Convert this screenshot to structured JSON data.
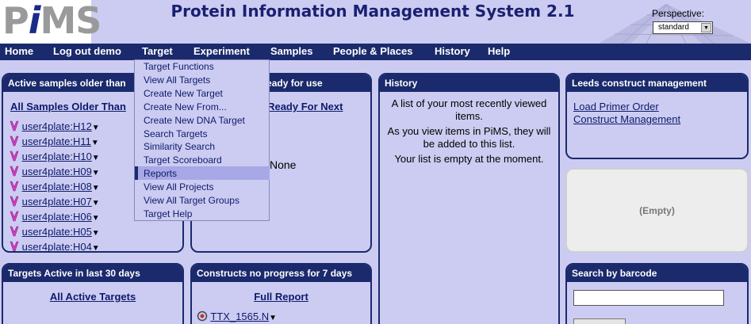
{
  "header": {
    "logo": "PiMS",
    "title": "Protein Information Management System 2.1",
    "perspective_label": "Perspective:",
    "perspective_value": "standard"
  },
  "nav": [
    "Home",
    "Log out demo",
    "Target",
    "Experiment",
    "Samples",
    "People & Places",
    "History",
    "Help"
  ],
  "target_menu": {
    "items": [
      "Target Functions",
      "View All Targets",
      "Create New Target",
      "Create New From...",
      "Create New DNA Target",
      "Search Targets",
      "Similarity Search",
      "Target Scoreboard",
      "Reports",
      "View All Projects",
      "View All Target Groups",
      "Target Help"
    ],
    "highlighted": "Reports"
  },
  "active_samples": {
    "title": "Active samples older than",
    "link": "All Samples Older Than",
    "items": [
      "user4plate:H12",
      "user4plate:H11",
      "user4plate:H10",
      "user4plate:H09",
      "user4plate:H08",
      "user4plate:H07",
      "user4plate:H06",
      "user4plate:H05",
      "user4plate:H04"
    ]
  },
  "ready_samples": {
    "title_visible": "e samples ready for use",
    "link_visible": "Samples Ready For Next",
    "value": "None"
  },
  "history": {
    "title": "History",
    "line1": "A list of your most recently viewed items.",
    "line2": "As you view items in PiMS, they will be added to this list.",
    "line3": "Your list is empty at the moment."
  },
  "leeds": {
    "title": "Leeds construct management",
    "links": [
      "Load Primer Order",
      "Construct Management"
    ]
  },
  "empty_panel": {
    "text": "(Empty)"
  },
  "targets_active": {
    "title": "Targets Active in last 30 days",
    "link": "All Active Targets"
  },
  "constructs": {
    "title": "Constructs no progress for 7 days",
    "link": "Full Report",
    "item": "TTX_1565.N"
  },
  "barcode": {
    "title": "Search by barcode"
  },
  "colors": {
    "navy": "#1a2a6c",
    "panel_bg": "#ccccf2",
    "link": "#0d1a6a",
    "highlight": "#a8a8e6"
  }
}
